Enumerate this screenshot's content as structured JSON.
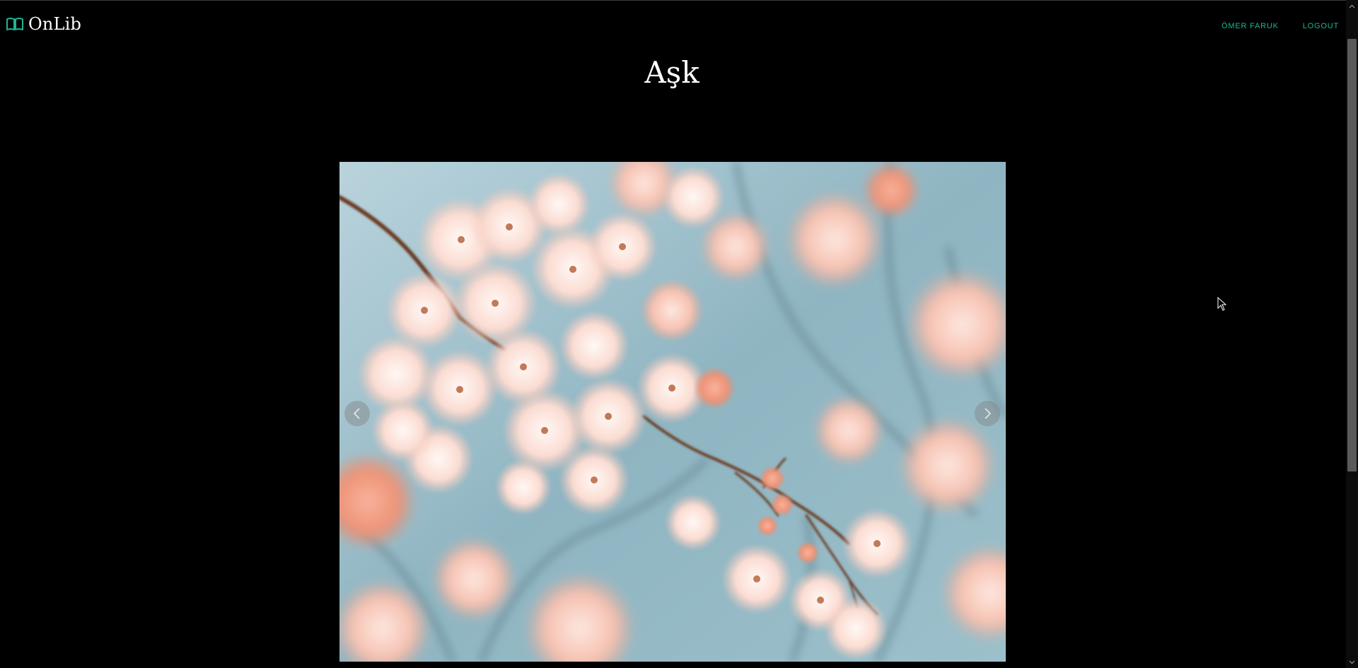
{
  "navbar": {
    "brand": "OnLib",
    "links": [
      {
        "label": "ÖMER FARUK"
      },
      {
        "label": "LOGOUT"
      }
    ],
    "accent_color": "#20b494"
  },
  "main": {
    "title": "Aşk"
  },
  "carousel": {
    "image_icon": "cherry-blossom-image",
    "prev_icon": "chevron-left-icon",
    "next_icon": "chevron-right-icon"
  }
}
